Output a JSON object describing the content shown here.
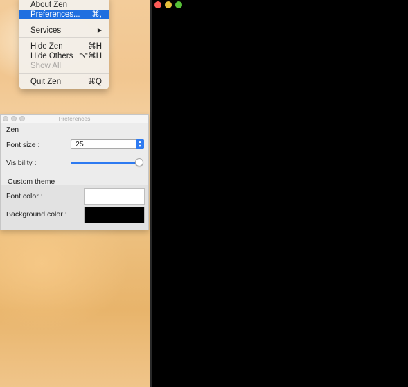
{
  "menu": {
    "items": [
      {
        "label": "About Zen",
        "shortcut": ""
      },
      {
        "label": "Preferences...",
        "shortcut": "⌘,"
      },
      {
        "label": "Services",
        "shortcut": "▶"
      },
      {
        "label": "Hide Zen",
        "shortcut": "⌘H"
      },
      {
        "label": "Hide Others",
        "shortcut": "⌥⌘H"
      },
      {
        "label": "Show All",
        "shortcut": ""
      },
      {
        "label": "Quit Zen",
        "shortcut": "⌘Q"
      }
    ]
  },
  "prefs": {
    "title": "Preferences",
    "section_zen": "Zen",
    "font_size_label": "Font size :",
    "font_size_value": "25",
    "visibility_label": "Visibility :",
    "visibility_fraction": 1.0,
    "section_theme": "Custom theme",
    "font_color_label": "Font color :",
    "font_color": "#ffffff",
    "background_color_label": "Background color :",
    "background_color": "#000000"
  },
  "colors": {
    "accent": "#1f6fe0",
    "traffic_red": "#fc5b57",
    "traffic_yellow": "#e5bf3c",
    "traffic_green": "#57c038"
  },
  "icons": {
    "stepper": "chevron-up-down-icon",
    "submenu": "chevron-right-icon"
  }
}
